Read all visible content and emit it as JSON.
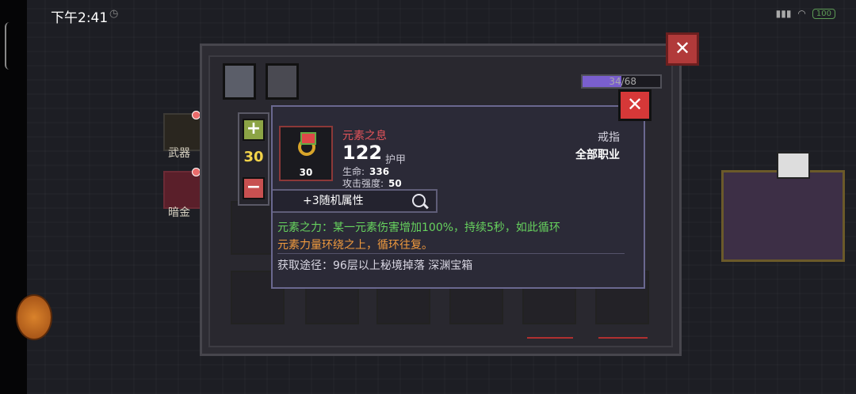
{
  "status_bar": {
    "time": "下午2:41",
    "battery": "100"
  },
  "sidebar": {
    "items": [
      {
        "label": "武器"
      },
      {
        "label": "暗金"
      }
    ]
  },
  "inventory": {
    "capacity_text": "34/68",
    "capacity_fraction": 0.5,
    "tabs": [
      {
        "icon": "grid-icon"
      },
      {
        "icon": "armor-icon"
      }
    ]
  },
  "stepper": {
    "value": "30",
    "plus": "+",
    "minus": "−"
  },
  "item": {
    "name": "元素之息",
    "icon_level": "30",
    "value": "122",
    "value_type": "护甲",
    "stats": [
      {
        "label": "生命:",
        "value": "336"
      },
      {
        "label": "攻击强度:",
        "value": "50"
      }
    ],
    "slot_type": "戒指",
    "class_req": "全部职业",
    "random_attr": "+3随机属性",
    "effect_line1": "元素之力：某一元素伤害增加100%，持续5秒，如此循环",
    "effect_line2": "元素力量环绕之上，循环往复。",
    "source": "获取途径：96层以上秘境掉落 深渊宝箱"
  },
  "colors": {
    "item_name": "#e2545a",
    "effect_green": "#67d35e",
    "effect_orange": "#f09a3e",
    "quantity": "#f2d34a",
    "close_button": "#d63838"
  }
}
